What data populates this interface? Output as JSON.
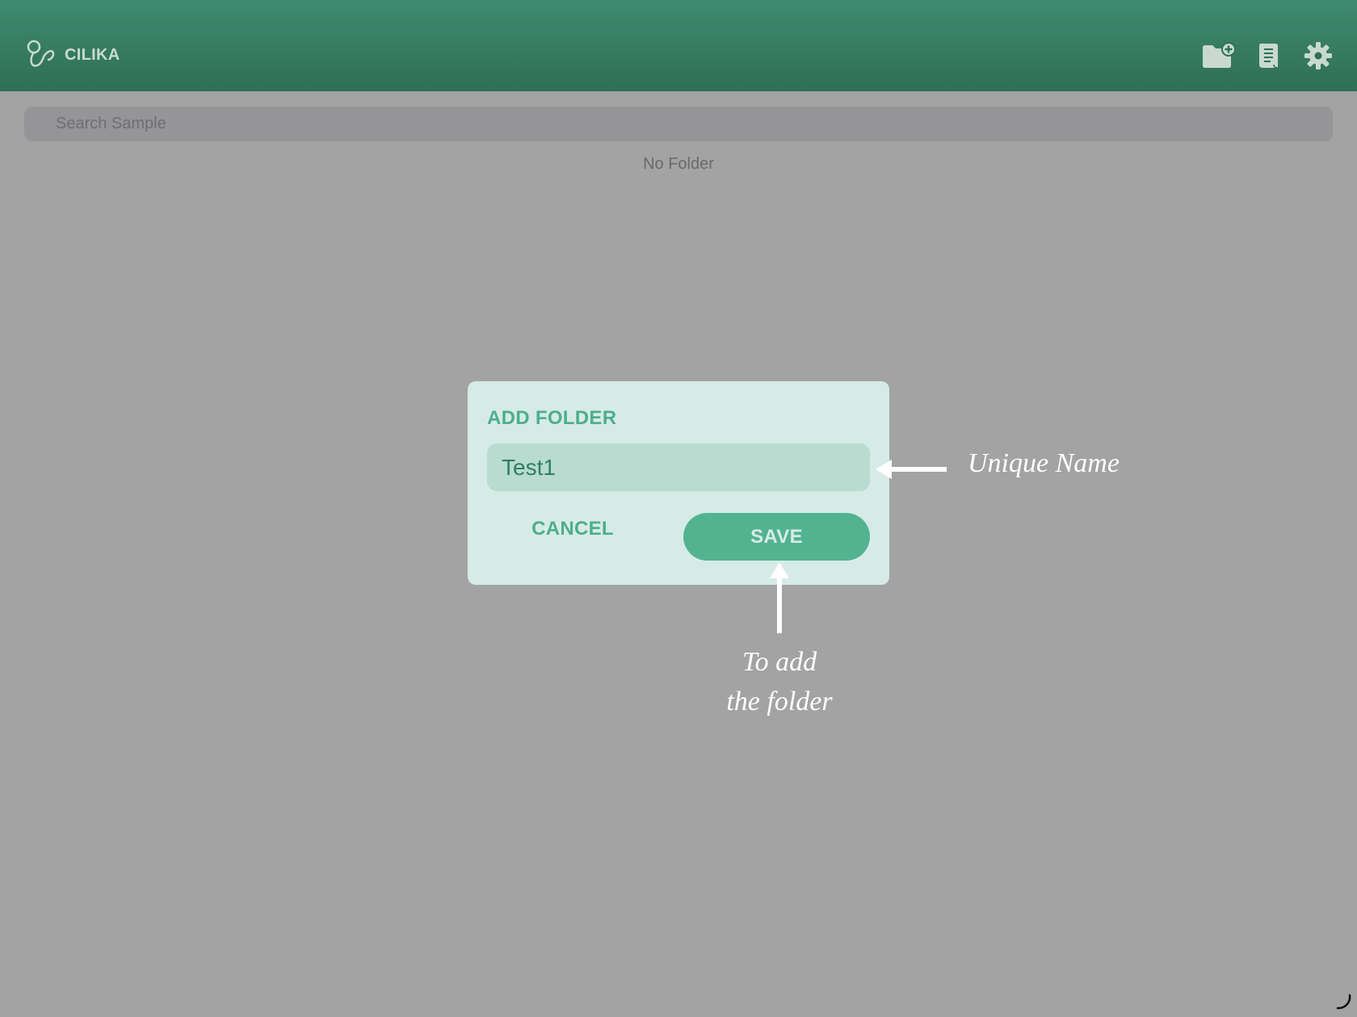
{
  "header": {
    "app_name": "CILIKA",
    "icons": [
      "add-folder-icon",
      "document-icon",
      "settings-icon"
    ]
  },
  "search": {
    "placeholder": "Search Sample"
  },
  "folders": {
    "empty_label": "No Folder"
  },
  "dialog": {
    "title": "ADD FOLDER",
    "input_value": "Test1",
    "cancel_label": "CANCEL",
    "save_label": "SAVE"
  },
  "annotations": {
    "unique_name": "Unique Name",
    "add_folder_line1": "To add",
    "add_folder_line2": "the folder"
  },
  "colors": {
    "header": "#347a60",
    "accent": "#4dae8d",
    "dialog_bg": "#d7ebe6",
    "input_bg": "#b8dccf",
    "overlay": "#a3a3a3"
  }
}
